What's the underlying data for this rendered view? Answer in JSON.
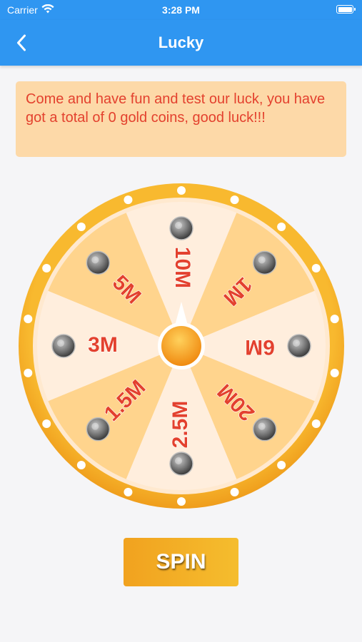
{
  "status_bar": {
    "carrier": "Carrier",
    "time": "3:28 PM"
  },
  "nav": {
    "title": "Lucky",
    "back_icon": "chevron-left-icon"
  },
  "notice": {
    "text": "Come and have fun and test our luck, you have got a total of 0 gold coins, good luck!!!"
  },
  "wheel": {
    "prizes": [
      "10M",
      "1M",
      "6M",
      "20M",
      "2.5M",
      "1.5M",
      "3M",
      "5M"
    ],
    "colors": {
      "rim": "#f3a722",
      "light": "#ffeedd",
      "dark": "#ffd48d",
      "label": "#e3412e",
      "hub": "#f5a623"
    }
  },
  "spin": {
    "label": "SPIN"
  },
  "colors": {
    "primary": "#2f96f1",
    "notice_bg": "#fdd9a8",
    "notice_text": "#e3412e"
  }
}
